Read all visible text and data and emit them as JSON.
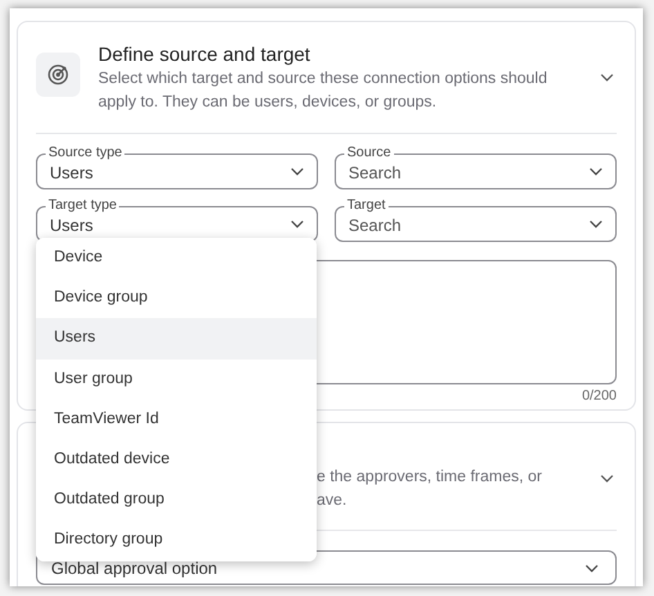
{
  "source_target": {
    "title": "Define source and target",
    "description": "Select which target and source these connection options should apply to. They can be users, devices, or groups.",
    "fields": [
      {
        "label": "Source type",
        "value": "Users"
      },
      {
        "label": "Source",
        "placeholder": "Search"
      },
      {
        "label": "Target type",
        "value": "Users"
      },
      {
        "label": "Target",
        "placeholder": "Search"
      }
    ],
    "counter": "0/200"
  },
  "dropdown": [
    {
      "label": "Device",
      "selected": false
    },
    {
      "label": "Device group",
      "selected": false
    },
    {
      "label": "Users",
      "selected": true
    },
    {
      "label": "User group",
      "selected": false
    },
    {
      "label": "TeamViewer Id",
      "selected": false
    },
    {
      "label": "Outdated device",
      "selected": false
    },
    {
      "label": "Outdated group",
      "selected": false
    },
    {
      "label": "Directory group",
      "selected": false
    }
  ],
  "approval": {
    "description_lines": [
      "e the approvers, time frames, or",
      "ave."
    ],
    "field_value": "Global approval option"
  }
}
